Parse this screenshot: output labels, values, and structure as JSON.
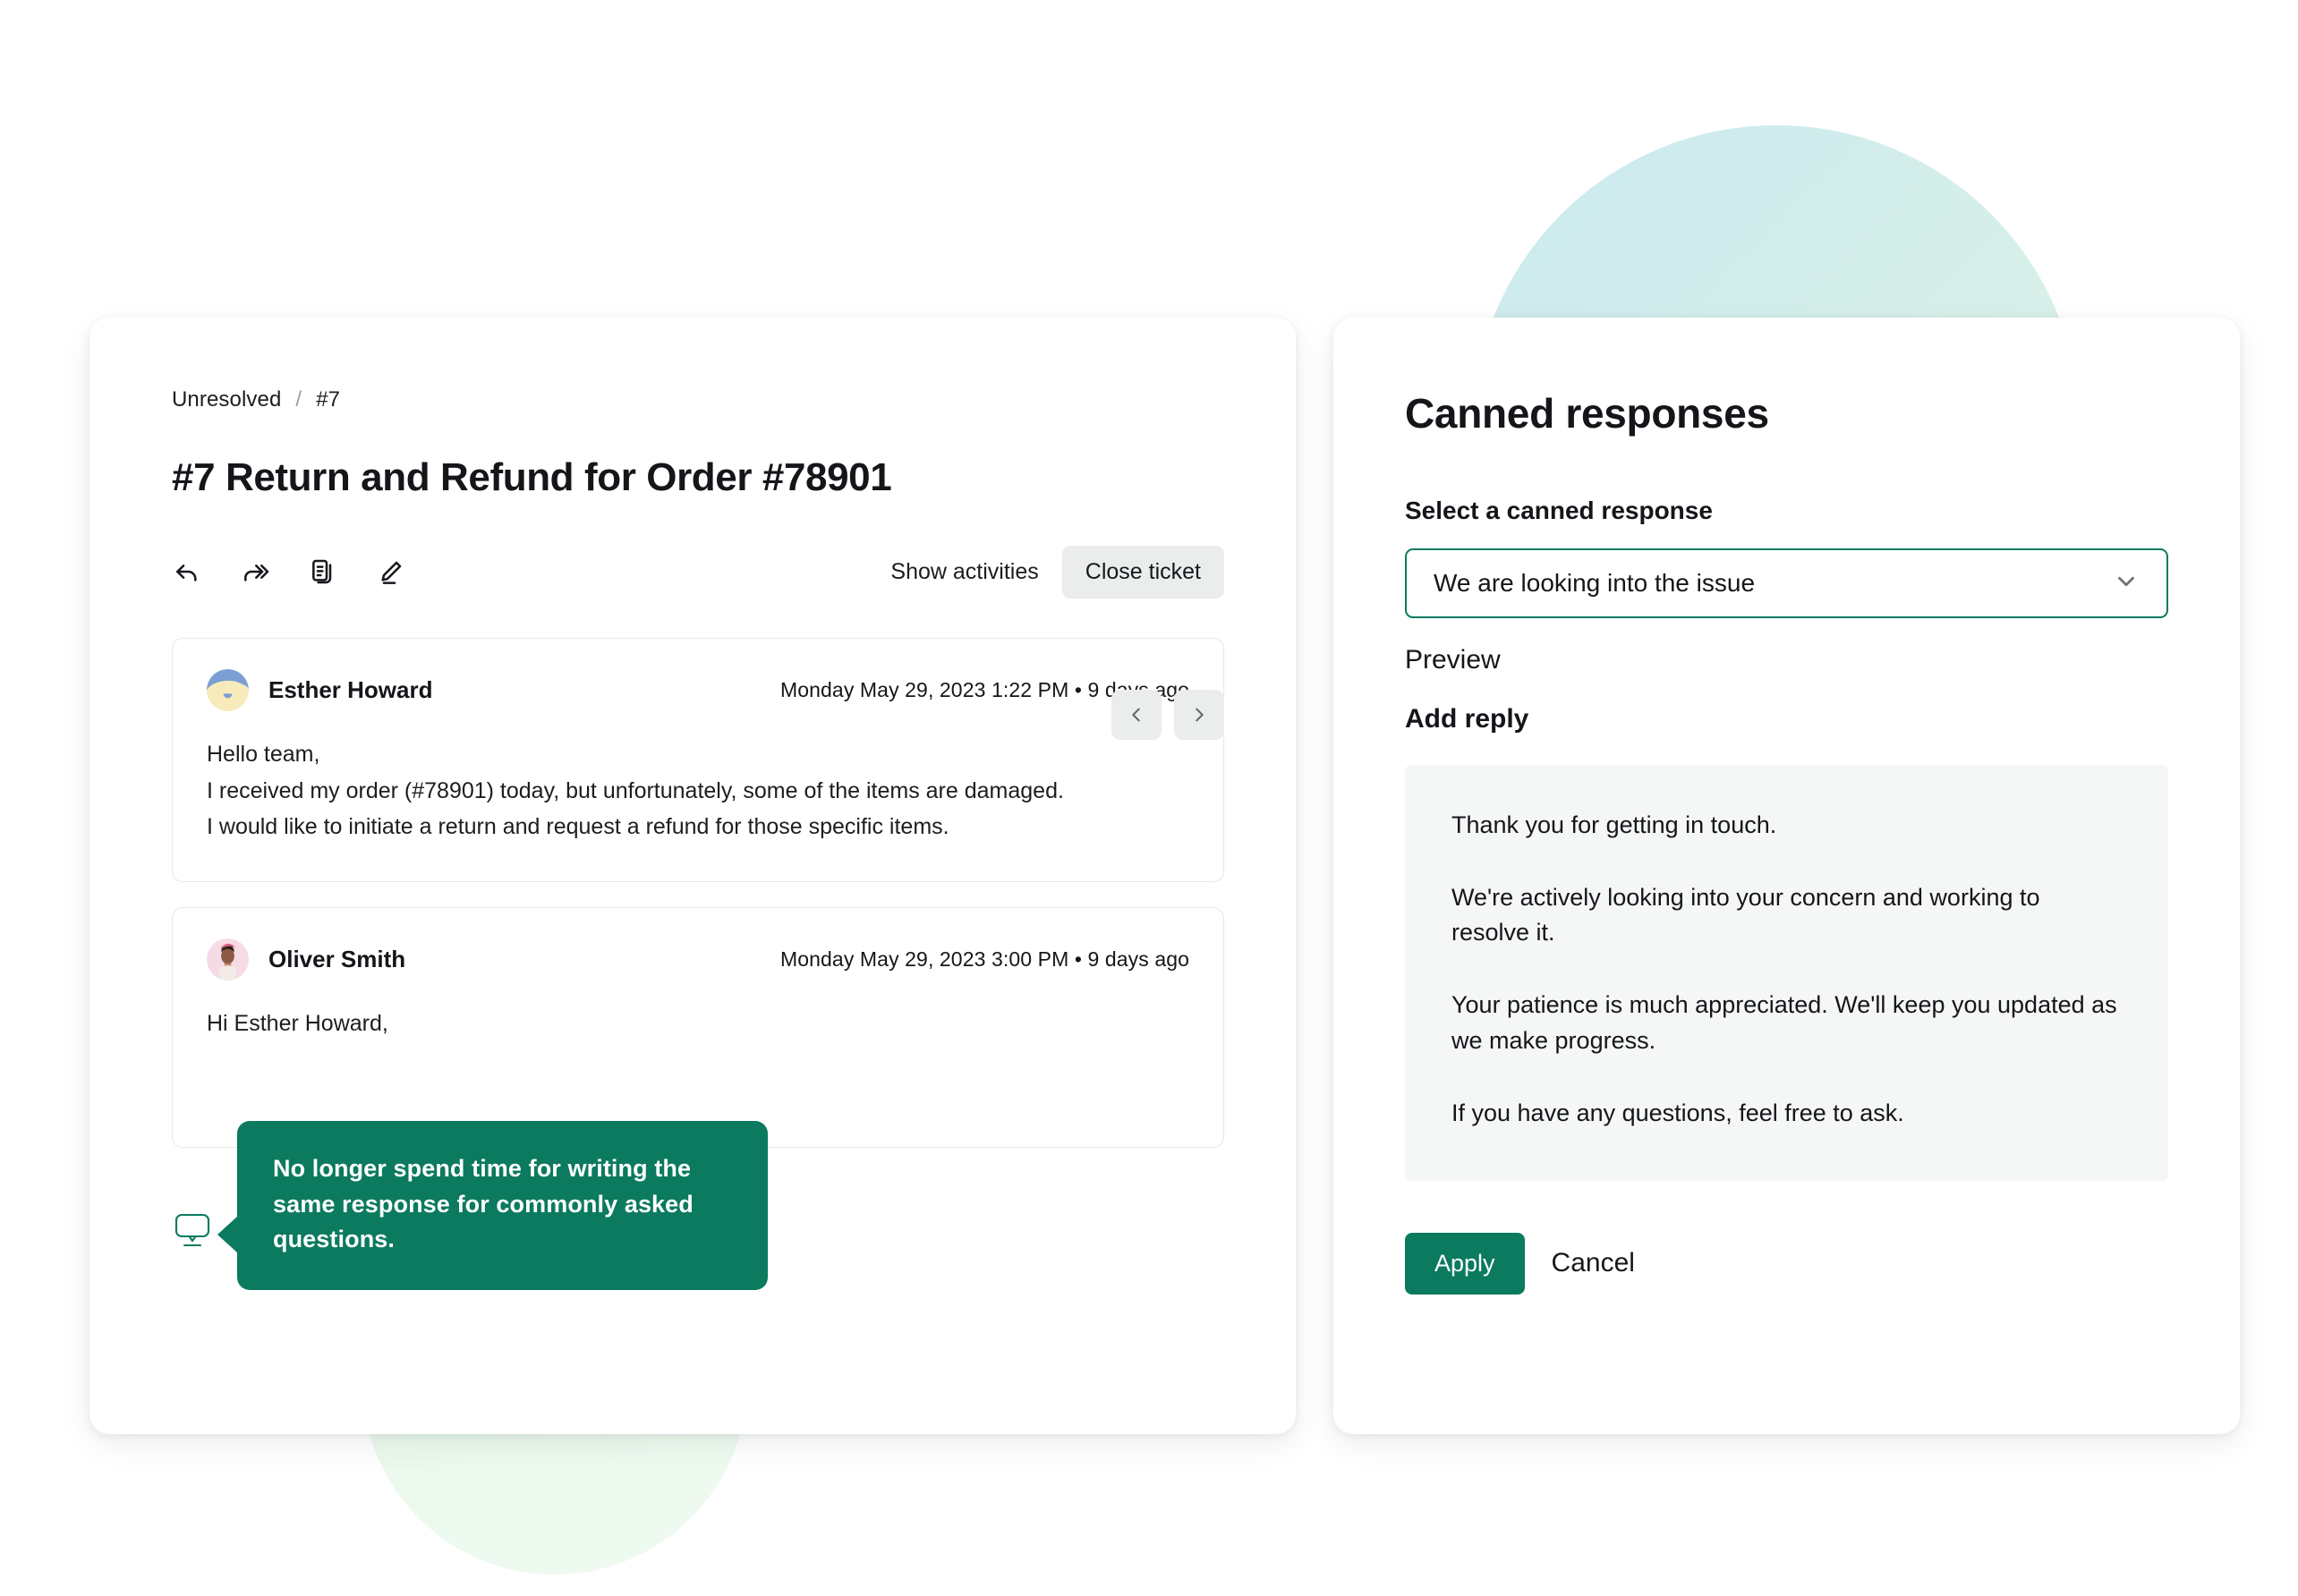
{
  "ticket_panel": {
    "breadcrumb": {
      "status": "Unresolved",
      "separator": "/",
      "ticket_id": "#7"
    },
    "nav": {
      "prev_icon": "chevron-left-icon",
      "next_icon": "chevron-right-icon"
    },
    "title": "#7 Return and Refund for Order #78901",
    "tools": [
      {
        "name": "reply-icon",
        "label": "Reply"
      },
      {
        "name": "forward-icon",
        "label": "Forward"
      },
      {
        "name": "duplicate-icon",
        "label": "Duplicate"
      },
      {
        "name": "edit-icon",
        "label": "Edit"
      }
    ],
    "show_activities": "Show activities",
    "close_ticket": "Close ticket",
    "messages": [
      {
        "author": "Esther Howard",
        "timestamp": "Monday May 29, 2023 1:22 PM • 9 days ago",
        "lines": [
          "Hello team,",
          "I received my order (#78901) today, but unfortunately, some of the items are damaged.",
          "I would like to initiate a return and request a refund for those specific items."
        ]
      },
      {
        "author": "Oliver Smith",
        "timestamp": "Monday May 29, 2023 3:00 PM • 9 days ago",
        "lines": [
          "Hi Esther Howard,"
        ]
      }
    ],
    "callout": {
      "icon": "monitor-icon",
      "text": "No longer spend time for writing the same response for commonly asked questions."
    }
  },
  "canned_panel": {
    "title": "Canned responses",
    "select_label": "Select a canned response",
    "selected_response": "We are looking into the issue",
    "chevron_icon": "chevron-down-icon",
    "preview_label": "Preview",
    "add_reply_label": "Add reply",
    "preview_paragraphs": [
      "Thank you for getting in touch.",
      "We're actively looking into your concern and working to resolve it.",
      "Your patience is much appreciated. We'll keep you updated as we make progress.",
      "If you have any questions, feel free to ask."
    ],
    "apply_label": "Apply",
    "cancel_label": "Cancel"
  },
  "theme": {
    "accent": "#0b7a5f",
    "surface_muted": "#ebecec",
    "preview_bg": "#f5f6f6",
    "blob_cyan": "#c8e8ef",
    "blob_green": "#e3f7e6"
  }
}
